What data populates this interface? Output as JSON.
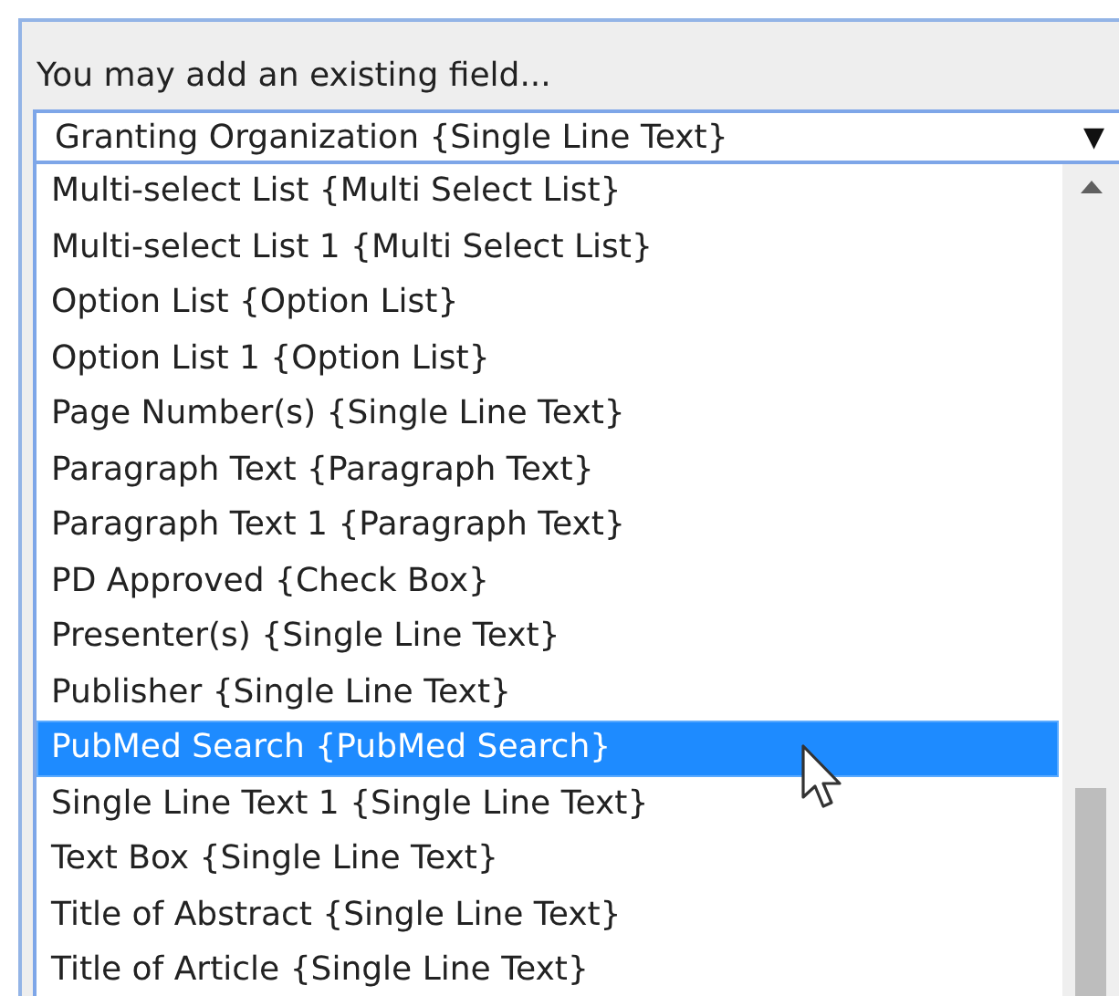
{
  "label": "You may add an existing field...",
  "select": {
    "value": "Granting Organization {Single Line Text}",
    "expanded": true,
    "arrow": "▼"
  },
  "options": [
    {
      "label": "Multi-select List {Multi Select List}",
      "selected": false
    },
    {
      "label": "Multi-select List 1 {Multi Select List}",
      "selected": false
    },
    {
      "label": "Option List {Option List}",
      "selected": false
    },
    {
      "label": "Option List 1 {Option List}",
      "selected": false
    },
    {
      "label": "Page Number(s) {Single Line Text}",
      "selected": false
    },
    {
      "label": "Paragraph Text {Paragraph Text}",
      "selected": false
    },
    {
      "label": "Paragraph Text 1 {Paragraph Text}",
      "selected": false
    },
    {
      "label": "PD Approved {Check Box}",
      "selected": false
    },
    {
      "label": "Presenter(s) {Single Line Text}",
      "selected": false
    },
    {
      "label": "Publisher {Single Line Text}",
      "selected": false
    },
    {
      "label": "PubMed Search {PubMed Search}",
      "selected": true
    },
    {
      "label": "Single Line Text 1 {Single Line Text}",
      "selected": false
    },
    {
      "label": "Text Box {Single Line Text}",
      "selected": false
    },
    {
      "label": "Title of Abstract {Single Line Text}",
      "selected": false
    },
    {
      "label": "Title of Article {Single Line Text}",
      "selected": false
    }
  ]
}
